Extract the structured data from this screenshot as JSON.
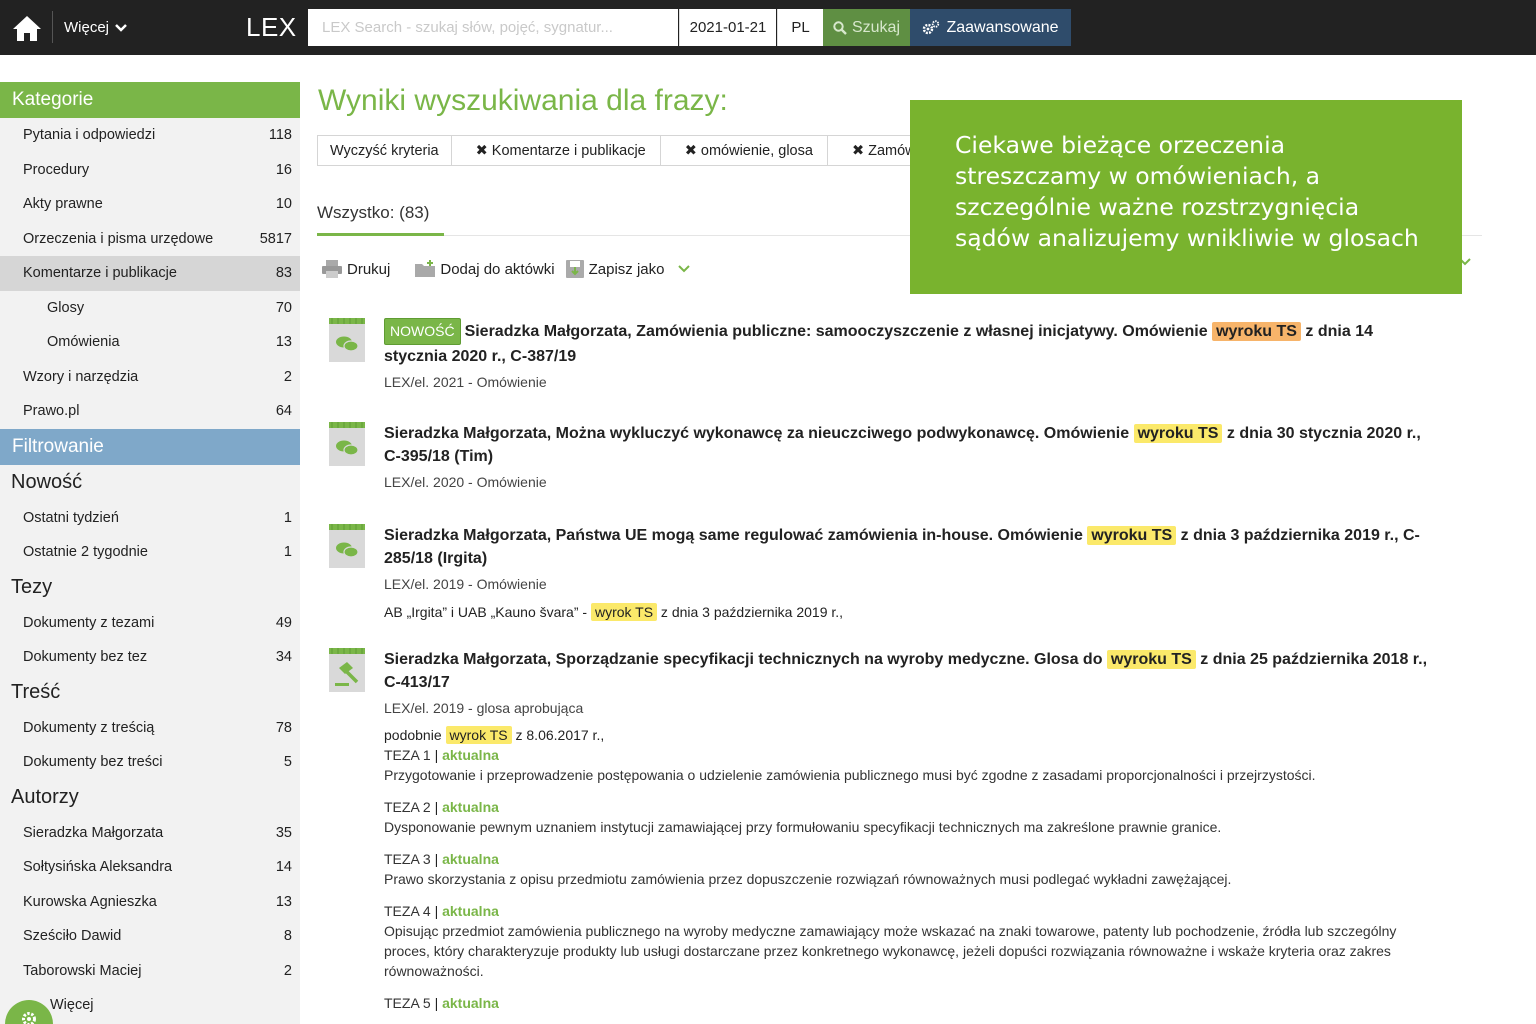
{
  "topbar": {
    "more_label": "Więcej",
    "logo": "LEX",
    "search_placeholder": "LEX Search - szukaj słów, pojęć, sygnatur...",
    "search_value": "",
    "date": "2021-01-21",
    "lang": "PL",
    "search_button": "Szukaj",
    "advanced_button": "Zaawansowane"
  },
  "sidebar": {
    "categories_title": "Kategorie",
    "categories": [
      {
        "label": "Pytania i odpowiedzi",
        "count": "118"
      },
      {
        "label": "Procedury",
        "count": "16"
      },
      {
        "label": "Akty prawne",
        "count": "10"
      },
      {
        "label": "Orzeczenia i pisma urzędowe",
        "count": "5817"
      },
      {
        "label": "Komentarze i publikacje",
        "count": "83"
      },
      {
        "label": "Glosy",
        "count": "70"
      },
      {
        "label": "Omówienia",
        "count": "13"
      },
      {
        "label": "Wzory i narzędzia",
        "count": "2"
      },
      {
        "label": "Prawo.pl",
        "count": "64"
      }
    ],
    "filter_title": "Filtrowanie",
    "groups": [
      {
        "title": "Nowość",
        "items": [
          {
            "label": "Ostatni tydzień",
            "count": "1"
          },
          {
            "label": "Ostatnie 2 tygodnie",
            "count": "1"
          }
        ]
      },
      {
        "title": "Tezy",
        "items": [
          {
            "label": "Dokumenty z tezami",
            "count": "49"
          },
          {
            "label": "Dokumenty bez tez",
            "count": "34"
          }
        ]
      },
      {
        "title": "Treść",
        "items": [
          {
            "label": "Dokumenty z treścią",
            "count": "78"
          },
          {
            "label": "Dokumenty bez treści",
            "count": "5"
          }
        ]
      },
      {
        "title": "Autorzy",
        "items": [
          {
            "label": "Sieradzka Małgorzata",
            "count": "35"
          },
          {
            "label": "Sołtysińska Aleksandra",
            "count": "14"
          },
          {
            "label": "Kurowska Agnieszka",
            "count": "13"
          },
          {
            "label": "Sześciło Dawid",
            "count": "8"
          },
          {
            "label": "Taborowski Maciej",
            "count": "2"
          }
        ]
      }
    ],
    "more_link": "Więcej"
  },
  "main": {
    "title": "Wyniki wyszukiwania dla frazy:",
    "clear_label": "Wyczyść kryteria",
    "chips": [
      "Komentarze i publikacje",
      "omówienie, glosa",
      "Zamówienia publiczne"
    ],
    "tab_all": "Wszystko: (83)",
    "actions": {
      "print": "Drukuj",
      "add": "Dodaj do aktówki",
      "save": "Zapisz jako"
    }
  },
  "results": [
    {
      "badge": "NOWOŚĆ",
      "title_pre": "Sieradzka Małgorzata, Zamówienia publiczne: samooczyszczenie z własnej inicjatywy. Omówienie ",
      "title_hl": "wyroku TS",
      "title_post": " z dnia 14 stycznia 2020 r., C-387/19",
      "meta": "LEX/el. 2021 - Omówienie"
    },
    {
      "title_pre": "Sieradzka Małgorzata, Można wykluczyć wykonawcę za nieuczciwego podwykonawcę. Omówienie ",
      "title_hl": "wyroku TS",
      "title_post": " z dnia 30 stycznia 2020 r., C-395/18 (Tim)",
      "meta": "LEX/el. 2020 - Omówienie"
    },
    {
      "title_pre": "Sieradzka Małgorzata, Państwa UE mogą same regulować zamówienia in-house. Omówienie ",
      "title_hl": "wyroku TS",
      "title_post": " z dnia 3 października 2019 r., C-285/18 (Irgita)",
      "meta": "LEX/el. 2019 - Omówienie",
      "extra_pre": "AB „Irgita” i UAB „Kauno švara” - ",
      "extra_hl": "wyrok TS",
      "extra_post": " z dnia 3 października 2019 r.,"
    },
    {
      "title_pre": "Sieradzka Małgorzata, Sporządzanie specyfikacji technicznych na wyroby medyczne. Glosa do ",
      "title_hl": "wyroku TS",
      "title_post": " z dnia 25 października 2018 r., C-413/17",
      "meta": "LEX/el. 2019 - glosa aprobująca",
      "extra_pre": "podobnie ",
      "extra_hl": "wyrok TS",
      "extra_post": " z 8.06.2017 r.,",
      "tezy": [
        {
          "no": "TEZA 1",
          "status": "aktualna",
          "text": "Przygotowanie i przeprowadzenie postępowania o udzielenie zamówienia publicznego musi być zgodne z zasadami proporcjonalności i przejrzystości."
        },
        {
          "no": "TEZA 2",
          "status": "aktualna",
          "text": "Dysponowanie pewnym uznaniem instytucji zamawiającej przy formułowaniu specyfikacji technicznych ma zakreślone prawnie granice."
        },
        {
          "no": "TEZA 3",
          "status": "aktualna",
          "text": "Prawo skorzystania z opisu przedmiotu zamówienia przez dopuszczenie rozwiązań równoważnych musi podlegać wykładni zawężającej."
        },
        {
          "no": "TEZA 4",
          "status": "aktualna",
          "text": "Opisując przedmiot zamówienia publicznego na wyroby medyczne zamawiający może wskazać na znaki towarowe, patenty lub pochodzenie, źródła lub szczególny proces, który charakteryzuje produkty lub usługi dostarczane przez konkretnego wykonawcę, jeżeli dopuści rozwiązania równoważne i wskaże kryteria oraz zakres równoważności."
        },
        {
          "no": "TEZA 5",
          "status": "aktualna",
          "text": ""
        }
      ]
    }
  ],
  "callout": {
    "text": "Ciekawe bieżące orzeczenia streszczamy w omówieniach, a szczególnie ważne rozstrzygnięcia sądów analizujemy wnikliwie w glosach"
  }
}
